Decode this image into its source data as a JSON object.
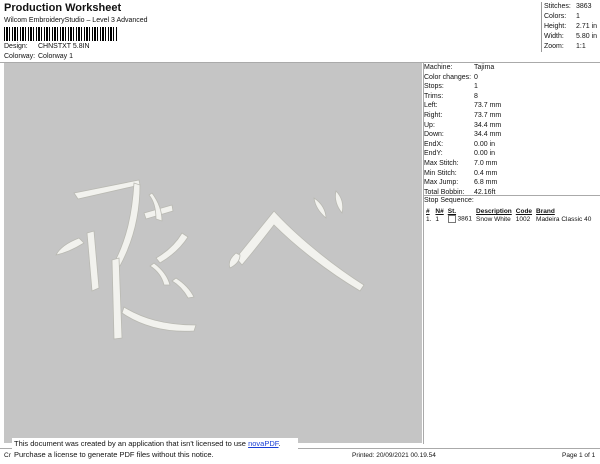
{
  "header": {
    "title": "Production Worksheet",
    "subtitle": "Wilcom EmbroideryStudio – Level 3 Advanced",
    "design_label": "Design:",
    "design_value": "CHNSTXT 5.8IN",
    "colorway_label": "Colorway:",
    "colorway_value": "Colorway 1"
  },
  "stats": [
    {
      "label": "Stitches:",
      "value": "3863"
    },
    {
      "label": "Colors:",
      "value": "1"
    },
    {
      "label": "Height:",
      "value": "2.71 in"
    },
    {
      "label": "Width:",
      "value": "5.80 in"
    },
    {
      "label": "Zoom:",
      "value": "1:1"
    }
  ],
  "machine": [
    {
      "label": "Machine:",
      "value": "Tajima"
    },
    {
      "label": "Color changes:",
      "value": "0"
    },
    {
      "label": "Stops:",
      "value": "1"
    },
    {
      "label": "Trims:",
      "value": "8"
    },
    {
      "label": "Left:",
      "value": "73.7 mm"
    },
    {
      "label": "Right:",
      "value": "73.7 mm"
    },
    {
      "label": "Up:",
      "value": "34.4 mm"
    },
    {
      "label": "Down:",
      "value": "34.4 mm"
    },
    {
      "label": "EndX:",
      "value": "0.00 in"
    },
    {
      "label": "EndY:",
      "value": "0.00 in"
    },
    {
      "label": "Max Stitch:",
      "value": "7.0 mm"
    },
    {
      "label": "Min Stitch:",
      "value": "0.4 mm"
    },
    {
      "label": "Max Jump:",
      "value": "6.8 mm"
    },
    {
      "label": "Total Bobbin:",
      "value": "42.16ft"
    }
  ],
  "stop_sequence": {
    "title": "Stop Sequence:",
    "headers": [
      "#",
      "N#",
      "St.",
      "Description",
      "Code",
      "Brand"
    ],
    "rows": [
      {
        "num": "1.",
        "n": "1",
        "st": "3861",
        "description": "Snow White",
        "code": "1002",
        "brand": "Madeira Classic 40"
      }
    ]
  },
  "notice": {
    "line1": "This document was created by an application that isn't licensed to use ",
    "link": "novaPDF",
    "line1_end": ".",
    "line2": "Purchase a license to generate PDF files without this notice."
  },
  "footer": {
    "left": "Cr",
    "printed": "Printed: 20/09/2021 00.19.54",
    "page": "Page 1 of 1"
  },
  "colors": {
    "canvas": "#c5c5c5",
    "thread": "#f2f2ee"
  }
}
